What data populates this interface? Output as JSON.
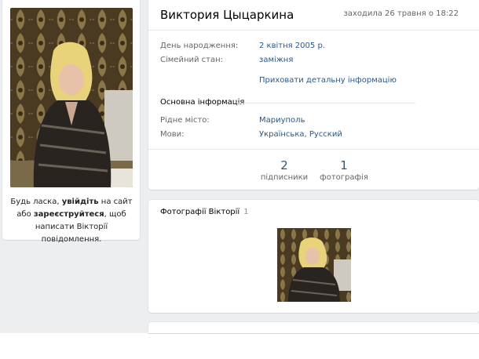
{
  "profile": {
    "name": "Виктория Цыцаркина",
    "last_seen": "заходила 26 травня о 18:22",
    "details": [
      {
        "label": "День народження:",
        "value": "2 квітня 2005 р."
      },
      {
        "label": "Сімейний стан:",
        "value": "заміжня"
      }
    ],
    "hide_details_link": "Приховати детальну інформацію",
    "basic_info_title": "Основна інформація",
    "basic_info": [
      {
        "label": "Рідне місто:",
        "value": "Мариуполь"
      },
      {
        "label": "Мови:",
        "value": "Українська, Русский"
      }
    ],
    "counters": [
      {
        "num": "2",
        "label": "підписники"
      },
      {
        "num": "1",
        "label": "фотографія"
      }
    ]
  },
  "left": {
    "msg_part1": "Будь ласка, ",
    "msg_login": "увійдіть",
    "msg_part2": " на сайт або ",
    "msg_register": "зареєструйтеся",
    "msg_part3": ", щоб написати Вікторії повідомлення."
  },
  "photos": {
    "title": "Фотографії Вікторії",
    "count": "1"
  },
  "colors": {
    "link": "#2a5885",
    "muted": "#656565",
    "page_bg": "#edeef0"
  }
}
